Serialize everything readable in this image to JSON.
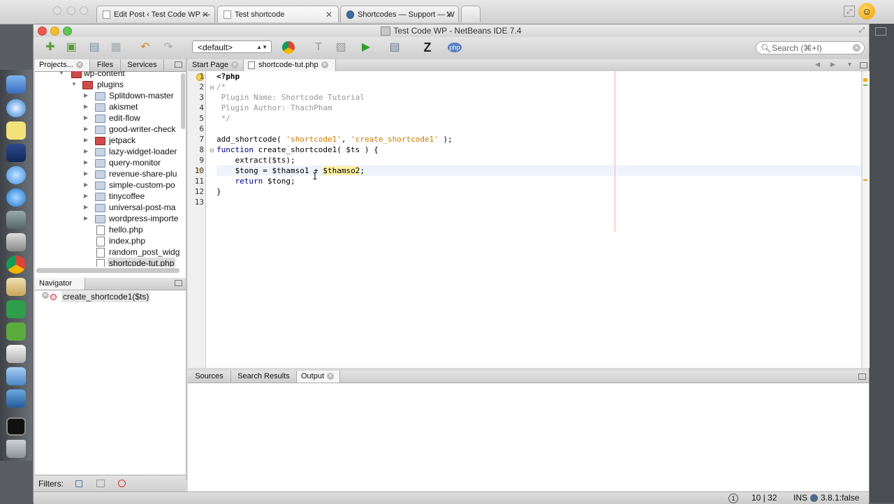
{
  "browser": {
    "tabs": [
      {
        "label": "Edit Post ‹ Test Code WP —"
      },
      {
        "label": "Test shortcode"
      },
      {
        "label": "Shortcodes — Support — W"
      }
    ]
  },
  "ide": {
    "title": "Test Code WP - NetBeans IDE 7.4",
    "config_label": "<default>",
    "search_placeholder": "Search (⌘+I)",
    "php_badge": "php"
  },
  "left_panel": {
    "tabs": [
      {
        "label": "Projects..."
      },
      {
        "label": "Files"
      },
      {
        "label": "Services"
      }
    ],
    "tree": [
      {
        "label": "wp-content"
      },
      {
        "label": "plugins"
      },
      {
        "label": "Splitdown-master"
      },
      {
        "label": "akismet"
      },
      {
        "label": "edit-flow"
      },
      {
        "label": "good-writer-check"
      },
      {
        "label": "jetpack"
      },
      {
        "label": "lazy-widget-loader"
      },
      {
        "label": "query-monitor"
      },
      {
        "label": "revenue-share-plu"
      },
      {
        "label": "simple-custom-po"
      },
      {
        "label": "tinycoffee"
      },
      {
        "label": "universal-post-ma"
      },
      {
        "label": "wordpress-importe"
      },
      {
        "label": "hello.php"
      },
      {
        "label": "index.php"
      },
      {
        "label": "random_post_widg"
      },
      {
        "label": "shortcode-tut.php"
      }
    ]
  },
  "navigator": {
    "tab_label": "Navigator",
    "item": "create_shortcode1($ts)"
  },
  "filters_label": "Filters:",
  "editor": {
    "tabs": [
      {
        "label": "Start Page"
      },
      {
        "label": "shortcode-tut.php"
      }
    ],
    "line_numbers": [
      "1",
      "2",
      "3",
      "4",
      "5",
      "6",
      "7",
      "8",
      "9",
      "10",
      "11",
      "12",
      "13"
    ],
    "code": {
      "l1": "<?php",
      "l2": "/*",
      "l3": " Plugin Name: Shortcode Tutorial",
      "l4": " Plugin Author: ThachPham",
      "l5": " */",
      "l7a": "add_shortcode( ",
      "l7b": "'shortcode1'",
      "l7c": ", ",
      "l7d": "'create_shortcode1'",
      "l7e": " );",
      "l8a": "function",
      "l8b": " create_shortcode1( $ts ) {",
      "l9": "    extract($ts);",
      "l10a": "    $tong = $thamso1 + ",
      "l10b": "$thamso2",
      "l10c": ";",
      "l11a": "    return",
      "l11b": " $tong;",
      "l12": "}"
    }
  },
  "output": {
    "tabs": [
      {
        "label": "Sources"
      },
      {
        "label": "Search Results"
      },
      {
        "label": "Output"
      }
    ]
  },
  "status": {
    "notifications": "1",
    "position": "10 | 32",
    "mode": "INS",
    "extra": "3.8.1:false"
  }
}
